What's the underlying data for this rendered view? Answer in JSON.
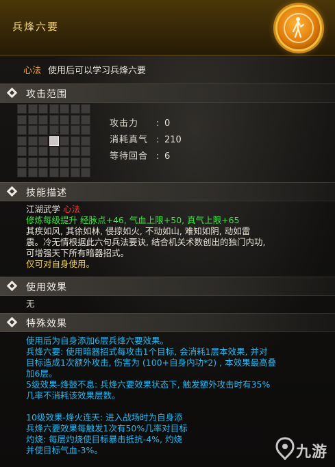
{
  "title": "兵烽六要",
  "subtitle": {
    "tag": "心法",
    "text": "使用后可以学习兵烽六要"
  },
  "sections": {
    "range": "攻击范围",
    "desc": "技能描述",
    "use": "使用效果",
    "special": "特殊效果"
  },
  "stats": [
    {
      "key": "攻击力",
      "value": "0"
    },
    {
      "key": "消耗真气",
      "value": "210"
    },
    {
      "key": "等待回合",
      "value": "6"
    }
  ],
  "range_grid": {
    "size": 7,
    "highlight": [
      3,
      3
    ]
  },
  "description": {
    "line1_prefix": "江湖武学 ",
    "line1_tag": "心法",
    "line2": "修炼每级提升 经脉点+46, 气血上限+50, 真气上限+65",
    "line3": "其疾如风, 其徐如林, 侵掠如火, 不动如山, 难知如阴, 动如雷",
    "line4": "震。冷无情根据此六句兵法要诀, 结合机关术数创出的独门内功,",
    "line5": "可增强天下所有暗器招式。",
    "line6": "仅可对自身使用。"
  },
  "use_effect": "无",
  "special": [
    "使用后为自身添加6层兵烽六要效果。",
    "兵烽六要: 使用暗器招式每攻击1个目标, 会消耗1层本效果, 并对",
    "目标造成1次额外攻击, 伤害为 (100+自身内功*2) , 本效果最高叠",
    "加6层。",
    "5级效果-烽鼓不息: 兵烽六要效果状态下, 触发额外攻击时有35%",
    "几率不消耗该效果层数。",
    "",
    "10级效果-烽火连天: 进入战场时为自身添",
    "兵烽六要效果每触发1次有50%几率对目标",
    "灼烧: 每层灼烧使目标暴击抵抗-4%, 灼烧",
    "并使目标气血-3%。"
  ],
  "watermark": "九游",
  "colors": {
    "gold_title": "#f2d47a",
    "orange_tag": "#f5a53a",
    "red": "#ff3b3b",
    "green": "#45e04a",
    "gold_text": "#f0cf5a",
    "blue": "#29b8f0"
  },
  "icons": {
    "emblem": "martial-figure-emblem-icon",
    "section_marker": "diamond-icon",
    "watermark": "jiuyou-logo-icon"
  }
}
